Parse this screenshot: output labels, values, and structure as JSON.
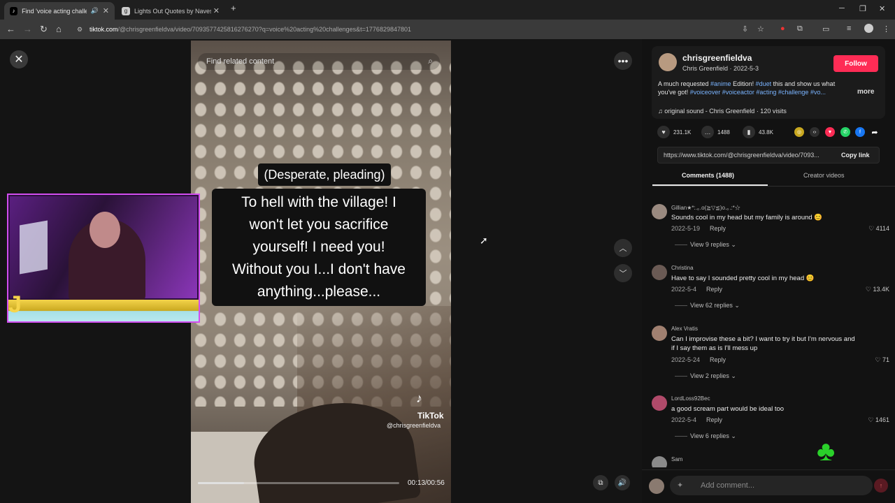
{
  "browser": {
    "tabs": [
      {
        "title": "Find 'voice acting challeng",
        "active": true
      },
      {
        "title": "Lights Out Quotes by Navessa",
        "active": false
      }
    ],
    "url_domain": "tiktok.com",
    "url_rest": "/@chrisgreenfieldva/video/7093577425816276270?q=voice%20acting%20challenges&t=1776829847801"
  },
  "video": {
    "search_placeholder": "Find related content",
    "caption_tone": "(Desperate, pleading)",
    "caption_lines": [
      "To hell with the village! I",
      "won't let you sacrifice",
      "yourself! I need you!",
      "Without you I...I don't have",
      "anything...please..."
    ],
    "watermark_brand": "TikTok",
    "watermark_user": "@chrisgreenfieldva",
    "time": "00:13/00:56",
    "progress": 0.23
  },
  "creator": {
    "username": "chrisgreenfieldva",
    "display_line": "Chris Greenfield · 2022-5-3",
    "follow_label": "Follow",
    "desc_1": "A much requested ",
    "tag_anime": "#anime",
    "desc_2": " Edition! ",
    "tag_duet": "#duet",
    "desc_3": " this and show us what you've got! ",
    "tag_voiceover": "#voiceover",
    "tag_voiceactor": "#voiceactor",
    "tag_acting": "#acting",
    "tag_challenge": "#challenge",
    "tag_vo": "#vo...",
    "more_label": "more",
    "sound": "♫  original sound - Chris Greenfield · 120 visits"
  },
  "stats": {
    "likes": "231.1K",
    "comments": "1488",
    "saves": "43.8K"
  },
  "share": {
    "link": "https://www.tiktok.com/@chrisgreenfieldva/video/7093...",
    "copy_label": "Copy link"
  },
  "tabs": {
    "comments": "Comments (1488)",
    "creator": "Creator videos"
  },
  "comments": [
    {
      "name": "Gillian★*:.｡.o(≧▽≦)o.｡.:*☆",
      "text": "Sounds cool in my head but my family is around 😊",
      "date": "2022-5-19",
      "reply": "Reply",
      "likes": "4114",
      "view": "View 9 replies ⌄"
    },
    {
      "name": "Christina",
      "text": "Have to say I sounded pretty cool in my head 😊",
      "date": "2022-5-4",
      "reply": "Reply",
      "likes": "13.4K",
      "view": "View 62 replies ⌄"
    },
    {
      "name": "Alex Vratis",
      "text": "Can I improvise these a bit? I want to try it but I'm nervous and if I say them as is I'll mess up",
      "date": "2022-5-24",
      "reply": "Reply",
      "likes": "71",
      "view": "View 2 replies ⌄"
    },
    {
      "name": "LordLoss92Bec",
      "text": "a good scream part would be ideal too",
      "date": "2022-5-4",
      "reply": "Reply",
      "likes": "1461",
      "view": "View 6 replies ⌄"
    },
    {
      "name": "Sam"
    }
  ],
  "add_comment_placeholder": "Add comment...",
  "colors": {
    "accent": "#fe2c55",
    "hashtag": "#7ab4ff",
    "bg": "#121212"
  }
}
